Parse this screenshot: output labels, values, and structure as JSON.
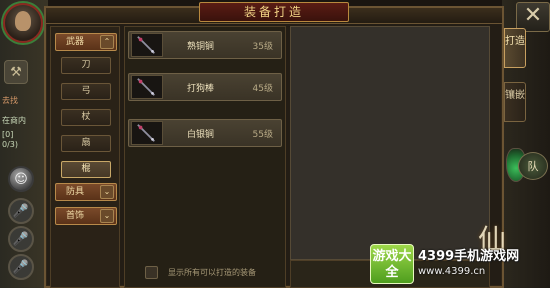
{
  "panel": {
    "title": "装备打造",
    "close_label": "✕"
  },
  "categories": [
    {
      "label": "武器",
      "expanded": true,
      "chevron": "⌃",
      "subs": [
        {
          "label": "刀",
          "selected": false
        },
        {
          "label": "弓",
          "selected": false
        },
        {
          "label": "杖",
          "selected": false
        },
        {
          "label": "扇",
          "selected": false
        },
        {
          "label": "棍",
          "selected": true
        }
      ]
    },
    {
      "label": "防具",
      "expanded": false,
      "chevron": "⌄"
    },
    {
      "label": "首饰",
      "expanded": false,
      "chevron": "⌄"
    }
  ],
  "items": [
    {
      "name": "熟铜锏",
      "level": "35级",
      "icon": "staff-weapon-icon"
    },
    {
      "name": "打狗棒",
      "level": "45级",
      "icon": "staff-weapon-icon"
    },
    {
      "name": "白银锏",
      "level": "55级",
      "icon": "staff-weapon-icon"
    }
  ],
  "show_all": {
    "label": "显示所有可以打造的装备",
    "checked": false
  },
  "side_tabs": [
    {
      "label": "打造",
      "active": true
    },
    {
      "label": "镶嵌",
      "active": false
    }
  ],
  "hud": {
    "left_texts": [
      "去找",
      "在商内",
      "[0]",
      "0/3)"
    ],
    "queue_label": "队"
  },
  "watermark": {
    "logo": "游戏大全",
    "main": "4399手机游戏网",
    "url": "www.4399.cn",
    "deco": "仙"
  },
  "colors": {
    "title_gold": "#f2d486",
    "panel_bg": "#231d15",
    "selected_border": "#c8a868",
    "accent_red": "#5a1c14"
  }
}
